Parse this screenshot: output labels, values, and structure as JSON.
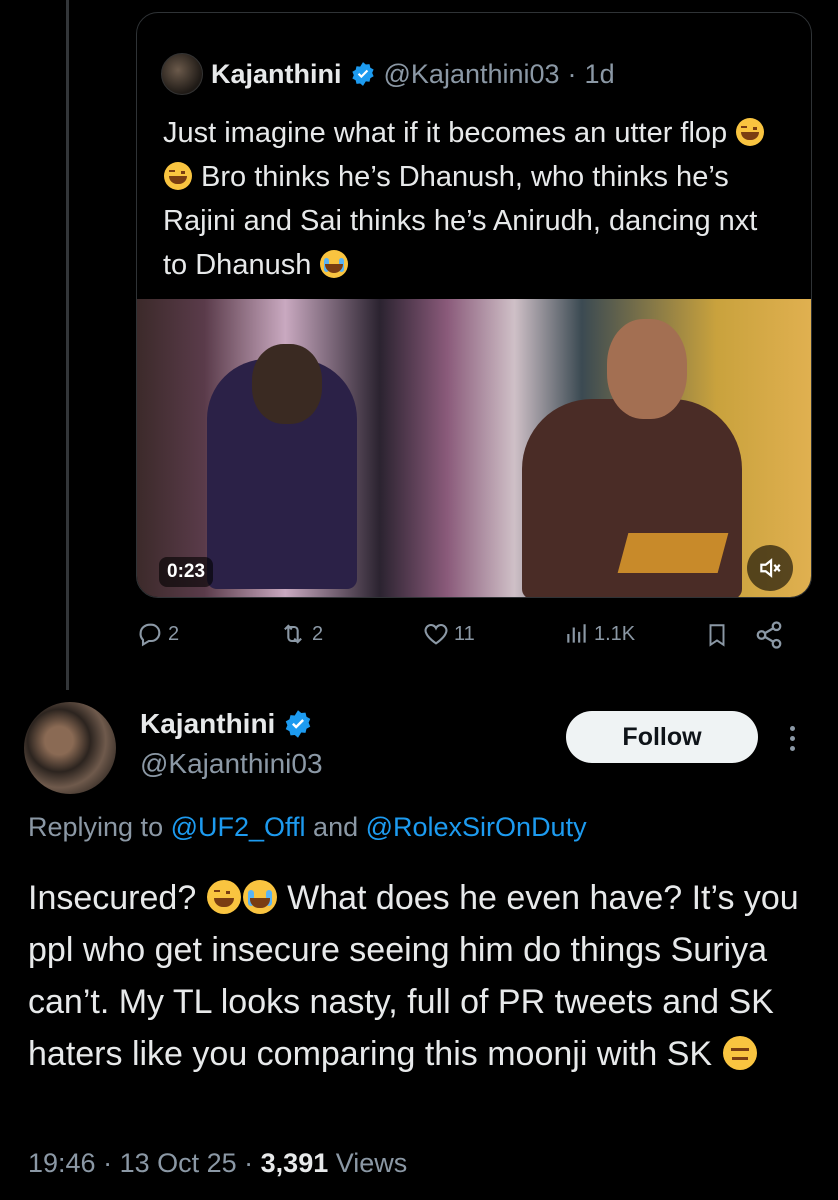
{
  "quoted_tweet": {
    "name": "Kajanthini",
    "handle": "@Kajanthini03",
    "separator": "·",
    "age": "1d",
    "text_part1": "Just imagine what if it becomes an utter flop",
    "text_part2": " Bro thinks he’s Dhanush, who thinks he’s Rajini and Sai thinks he’s Anirudh, dancing nxt to Dhanush",
    "video": {
      "duration": "0:23",
      "muted": true
    }
  },
  "actions": {
    "replies": "2",
    "reposts": "2",
    "likes": "11",
    "views": "1.1K"
  },
  "author": {
    "name": "Kajanthini",
    "handle": "@Kajanthini03",
    "follow_label": "Follow"
  },
  "replying": {
    "prefix": "Replying to ",
    "mention1": "@UF2_Offl",
    "joiner": " and ",
    "mention2": "@RolexSirOnDuty"
  },
  "tweet": {
    "part1": "Insecured? ",
    "part2": " What does he even have? It’s you ppl who get insecure seeing him do things Suriya can’t. My TL looks nasty, full of PR tweets and SK haters like you comparing this moonji with SK "
  },
  "meta": {
    "time": "19:46",
    "dot1": " · ",
    "date": "13 Oct 25",
    "dot2": " · ",
    "views_count": "3,391",
    "views_label": " Views"
  },
  "colors": {
    "background": "#000000",
    "text": "#e7e9ea",
    "secondary": "#8b98a5",
    "link": "#1d9bf0",
    "verified": "#1d9bf0"
  }
}
